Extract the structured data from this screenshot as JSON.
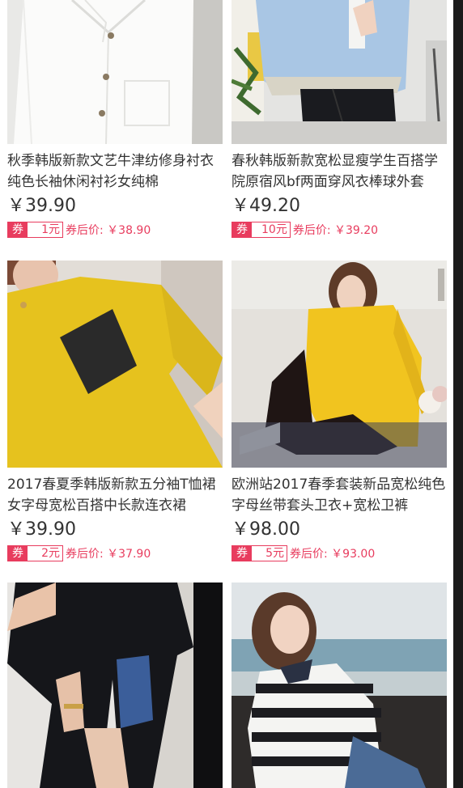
{
  "products": [
    {
      "title": "秋季韩版新款文艺牛津纺修身衬衣纯色长袖休闲衬衫女纯棉",
      "price": "￥39.90",
      "coupon_tag": "券",
      "coupon_amount": "1元",
      "after_coupon": "券后价: ￥38.90",
      "image_icon": "white-shirt-photo"
    },
    {
      "title": "春秋韩版新款宽松显瘦学生百搭学院原宿风bf两面穿风衣棒球外套",
      "price": "￥49.20",
      "coupon_tag": "券",
      "coupon_amount": "10元",
      "after_coupon": "券后价: ￥39.20",
      "image_icon": "blue-jacket-photo"
    },
    {
      "title": "2017春夏季韩版新款五分袖T恤裙女字母宽松百搭中长款连衣裙",
      "price": "￥39.90",
      "coupon_tag": "券",
      "coupon_amount": "2元",
      "after_coupon": "券后价: ￥37.90",
      "image_icon": "yellow-tshirt-dress-photo"
    },
    {
      "title": "欧洲站2017春季套装新品宽松纯色字母丝带套头卫衣+宽松卫裤",
      "price": "￥98.00",
      "coupon_tag": "券",
      "coupon_amount": "5元",
      "after_coupon": "券后价: ￥93.00",
      "image_icon": "yellow-sweatshirt-set-photo"
    },
    {
      "image_icon": "black-split-top-photo"
    },
    {
      "image_icon": "striped-sweater-photo"
    }
  ]
}
